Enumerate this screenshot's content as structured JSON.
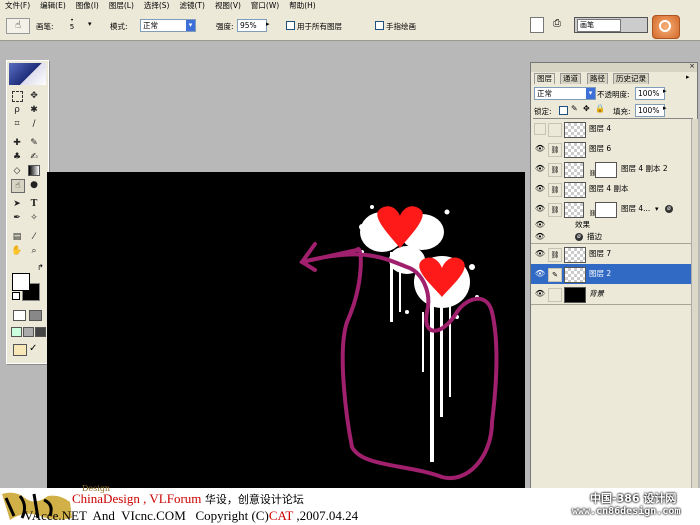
{
  "menu": [
    "文件(F)",
    "编辑(E)",
    "图像(I)",
    "图层(L)",
    "选择(S)",
    "滤镜(T)",
    "视图(V)",
    "窗口(W)",
    "帮助(H)"
  ],
  "options": {
    "brush_label": "画笔:",
    "brush_size": "5",
    "mode_label": "模式:",
    "mode_value": "正常",
    "strength_label": "强度:",
    "strength_value": "95%",
    "sample_all": "用于所有图层",
    "finger_paint": "手指绘画",
    "palette_well": "画笔"
  },
  "panel": {
    "tabs": [
      "图层",
      "通道",
      "路径",
      "历史记录"
    ],
    "blend_mode": "正常",
    "opacity_label": "不透明度:",
    "opacity_value": "100%",
    "lock_label": "锁定:",
    "fill_label": "填充:",
    "fill_value": "100%",
    "layers": [
      {
        "name": "图层 4",
        "visible": false,
        "mask": false,
        "selected": false
      },
      {
        "name": "图层 6",
        "visible": true,
        "mask": false,
        "selected": false
      },
      {
        "name": "图层 4 副本 2",
        "visible": true,
        "mask": true,
        "selected": false
      },
      {
        "name": "图层 4 副本",
        "visible": true,
        "mask": false,
        "selected": false
      },
      {
        "name": "图层 4...",
        "visible": true,
        "mask": true,
        "selected": false
      },
      {
        "name": "效果",
        "visible": true,
        "effect": true
      },
      {
        "name": "描边",
        "visible": true,
        "effect": true
      },
      {
        "name": "图层 7",
        "visible": true,
        "mask": false,
        "selected": false
      },
      {
        "name": "图层 2",
        "visible": true,
        "mask": false,
        "selected": true
      },
      {
        "name": "背景",
        "visible": true,
        "background": true
      }
    ]
  },
  "footer": {
    "line1_a": "ChinaDesign , ",
    "line1_b": "VLForum",
    "line1_c": " 华设，创意设计论坛",
    "line2": "VAcce.NET  And  VIcnc.COM   Copyright (C)",
    "line2_cat": "CAT",
    "line2_date": " ,2007.04.24",
    "watermark1": "中国-386 设计网",
    "watermark2": "www.cn86design.com",
    "design_tag": "Design"
  },
  "colors": {
    "selection": "#316ac5",
    "heart": "#ff1a1a",
    "stroke": "#a0206e",
    "accent_red": "#cc0000"
  }
}
